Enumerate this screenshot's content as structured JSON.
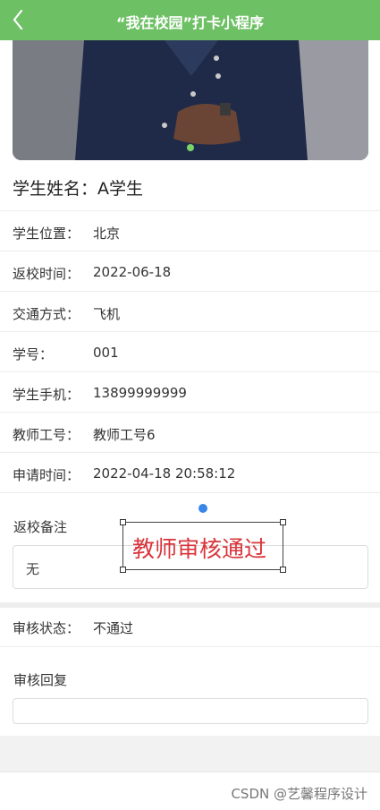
{
  "nav": {
    "title": "“我在校园”打卡小程序"
  },
  "student_name": {
    "label": "学生姓名：",
    "value": "A学生"
  },
  "fields": [
    {
      "label": "学生位置：",
      "value": "北京"
    },
    {
      "label": "返校时间：",
      "value": "2022-06-18"
    },
    {
      "label": "交通方式：",
      "value": "飞机"
    },
    {
      "label": "学号：",
      "value": "001"
    },
    {
      "label": "学生手机：",
      "value": "13899999999"
    },
    {
      "label": "教师工号：",
      "value": "教师工号6"
    },
    {
      "label": "申请时间：",
      "value": "2022-04-18 20:58:12"
    }
  ],
  "return_note": {
    "label": "返校备注",
    "value": "无"
  },
  "overlay": {
    "text": "教师审核通过"
  },
  "review_status": {
    "label": "审核状态：",
    "value": "不通过"
  },
  "review_reply": {
    "label": "审核回复",
    "value": ""
  },
  "watermark": "CSDN @艺馨程序设计",
  "colors": {
    "nav_bg": "#6ec065",
    "overlay_text": "#d9343a",
    "handle_dot": "#3a86e8"
  }
}
